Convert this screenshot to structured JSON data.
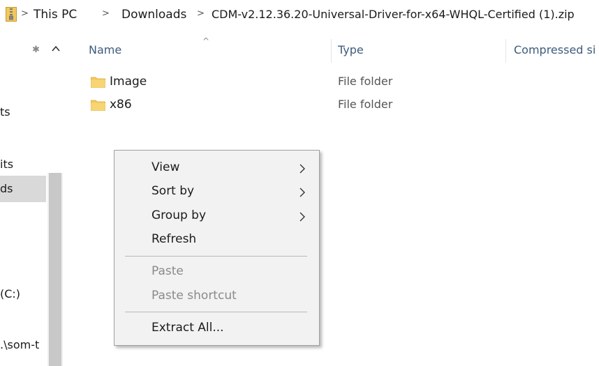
{
  "address_bar": {
    "crumbs": [
      "This PC",
      "Downloads",
      "CDM-v2.12.36.20-Universal-Driver-for-x64-WHQL-Certified (1).zip"
    ],
    "separator": ">"
  },
  "nav_pane": {
    "items": [
      {
        "label": "ts",
        "selected": false
      },
      {
        "label": "its",
        "selected": false
      },
      {
        "label": "ds",
        "selected": true
      },
      {
        "label": "(C:)",
        "selected": false
      },
      {
        "label": ".\\som-t",
        "selected": false
      }
    ]
  },
  "columns": {
    "name": "Name",
    "type": "Type",
    "compressed": "Compressed si"
  },
  "files": [
    {
      "name": "Image",
      "type": "File folder",
      "icon": "folder-icon"
    },
    {
      "name": "x86",
      "type": "File folder",
      "icon": "folder-icon"
    }
  ],
  "context_menu": {
    "view": "View",
    "sort_by": "Sort by",
    "group_by": "Group by",
    "refresh": "Refresh",
    "paste": "Paste",
    "paste_shortcut": "Paste shortcut",
    "extract_all": "Extract All..."
  },
  "colors": {
    "folder": "#f5c85a",
    "header_text": "#3c5b7b",
    "menu_bg": "#f2f2f2",
    "disabled_text": "#8a8a8a"
  }
}
